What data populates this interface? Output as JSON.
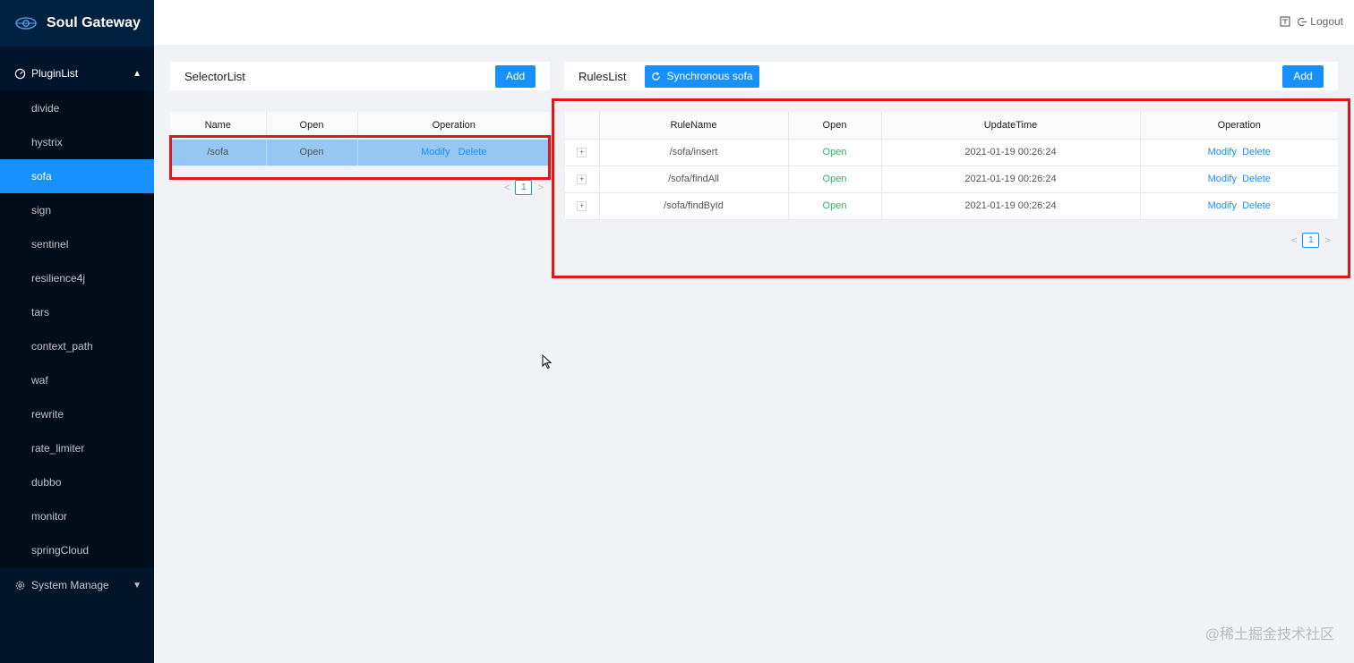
{
  "app": {
    "title": "Soul Gateway"
  },
  "header": {
    "logout_label": "Logout"
  },
  "sidebar": {
    "plugin_group_label": "PluginList",
    "items": [
      {
        "label": "divide"
      },
      {
        "label": "hystrix"
      },
      {
        "label": "sofa",
        "active": true
      },
      {
        "label": "sign"
      },
      {
        "label": "sentinel"
      },
      {
        "label": "resilience4j"
      },
      {
        "label": "tars"
      },
      {
        "label": "context_path"
      },
      {
        "label": "waf"
      },
      {
        "label": "rewrite"
      },
      {
        "label": "rate_limiter"
      },
      {
        "label": "dubbo"
      },
      {
        "label": "monitor"
      },
      {
        "label": "springCloud"
      }
    ],
    "system_group_label": "System Manage"
  },
  "selector": {
    "title": "SelectorList",
    "add_label": "Add",
    "columns": [
      "Name",
      "Open",
      "Operation"
    ],
    "rows": [
      {
        "name": "/sofa",
        "open": "Open",
        "modify": "Modify",
        "delete": "Delete"
      }
    ],
    "page": "1"
  },
  "rules": {
    "title": "RulesList",
    "sync_label": "Synchronous sofa",
    "add_label": "Add",
    "columns": [
      "",
      "RuleName",
      "Open",
      "UpdateTime",
      "Operation"
    ],
    "rows": [
      {
        "expand": "+",
        "name": "/sofa/insert",
        "open": "Open",
        "time": "2021-01-19 00:26:24",
        "modify": "Modify",
        "delete": "Delete"
      },
      {
        "expand": "+",
        "name": "/sofa/findAll",
        "open": "Open",
        "time": "2021-01-19 00:26:24",
        "modify": "Modify",
        "delete": "Delete"
      },
      {
        "expand": "+",
        "name": "/sofa/findById",
        "open": "Open",
        "time": "2021-01-19 00:26:24",
        "modify": "Modify",
        "delete": "Delete"
      }
    ],
    "page": "1"
  },
  "pager": {
    "prev": "<",
    "next": ">"
  },
  "watermark": "@稀土掘金技术社区",
  "colors": {
    "sidebar_bg": "#001529",
    "active": "#1890ff",
    "open_green": "#28b765",
    "highlight_box": "#e01717"
  }
}
